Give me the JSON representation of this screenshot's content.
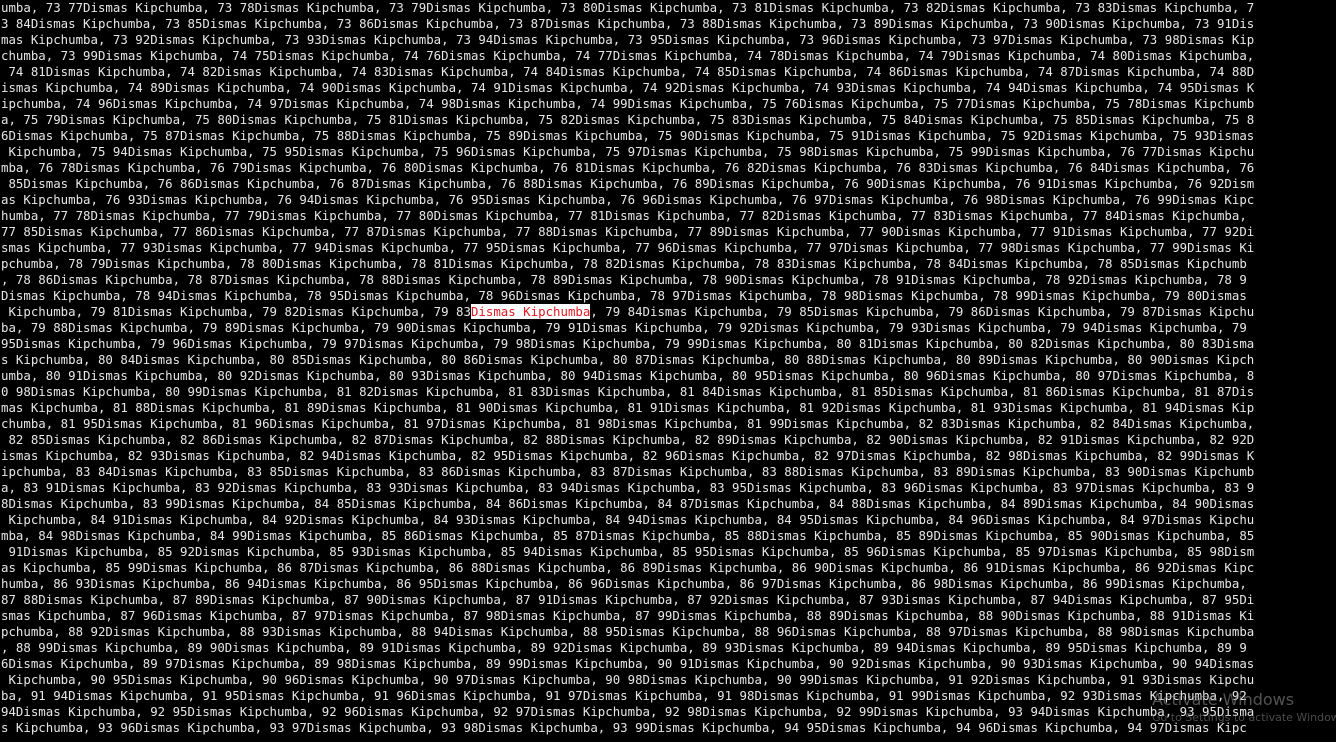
{
  "terminal": {
    "lines": [
      "umba, 73 77Dismas Kipchumba, 73 78Dismas Kipchumba, 73 79Dismas Kipchumba, 73 80Dismas Kipchumba, 73 81Dismas Kipchumba, 73 82Dismas Kipchumba, 73 83Dismas Kipchumba, 7",
      "3 84Dismas Kipchumba, 73 85Dismas Kipchumba, 73 86Dismas Kipchumba, 73 87Dismas Kipchumba, 73 88Dismas Kipchumba, 73 89Dismas Kipchumba, 73 90Dismas Kipchumba, 73 91Dis",
      "mas Kipchumba, 73 92Dismas Kipchumba, 73 93Dismas Kipchumba, 73 94Dismas Kipchumba, 73 95Dismas Kipchumba, 73 96Dismas Kipchumba, 73 97Dismas Kipchumba, 73 98Dismas Kip",
      "chumba, 73 99Dismas Kipchumba, 74 75Dismas Kipchumba, 74 76Dismas Kipchumba, 74 77Dismas Kipchumba, 74 78Dismas Kipchumba, 74 79Dismas Kipchumba, 74 80Dismas Kipchumba,",
      " 74 81Dismas Kipchumba, 74 82Dismas Kipchumba, 74 83Dismas Kipchumba, 74 84Dismas Kipchumba, 74 85Dismas Kipchumba, 74 86Dismas Kipchumba, 74 87Dismas Kipchumba, 74 88D",
      "ismas Kipchumba, 74 89Dismas Kipchumba, 74 90Dismas Kipchumba, 74 91Dismas Kipchumba, 74 92Dismas Kipchumba, 74 93Dismas Kipchumba, 74 94Dismas Kipchumba, 74 95Dismas K",
      "ipchumba, 74 96Dismas Kipchumba, 74 97Dismas Kipchumba, 74 98Dismas Kipchumba, 74 99Dismas Kipchumba, 75 76Dismas Kipchumba, 75 77Dismas Kipchumba, 75 78Dismas Kipchumb",
      "a, 75 79Dismas Kipchumba, 75 80Dismas Kipchumba, 75 81Dismas Kipchumba, 75 82Dismas Kipchumba, 75 83Dismas Kipchumba, 75 84Dismas Kipchumba, 75 85Dismas Kipchumba, 75 8",
      "6Dismas Kipchumba, 75 87Dismas Kipchumba, 75 88Dismas Kipchumba, 75 89Dismas Kipchumba, 75 90Dismas Kipchumba, 75 91Dismas Kipchumba, 75 92Dismas Kipchumba, 75 93Dismas",
      " Kipchumba, 75 94Dismas Kipchumba, 75 95Dismas Kipchumba, 75 96Dismas Kipchumba, 75 97Dismas Kipchumba, 75 98Dismas Kipchumba, 75 99Dismas Kipchumba, 76 77Dismas Kipchu",
      "mba, 76 78Dismas Kipchumba, 76 79Dismas Kipchumba, 76 80Dismas Kipchumba, 76 81Dismas Kipchumba, 76 82Dismas Kipchumba, 76 83Dismas Kipchumba, 76 84Dismas Kipchumba, 76",
      " 85Dismas Kipchumba, 76 86Dismas Kipchumba, 76 87Dismas Kipchumba, 76 88Dismas Kipchumba, 76 89Dismas Kipchumba, 76 90Dismas Kipchumba, 76 91Dismas Kipchumba, 76 92Dism",
      "as Kipchumba, 76 93Dismas Kipchumba, 76 94Dismas Kipchumba, 76 95Dismas Kipchumba, 76 96Dismas Kipchumba, 76 97Dismas Kipchumba, 76 98Dismas Kipchumba, 76 99Dismas Kipc",
      "humba, 77 78Dismas Kipchumba, 77 79Dismas Kipchumba, 77 80Dismas Kipchumba, 77 81Dismas Kipchumba, 77 82Dismas Kipchumba, 77 83Dismas Kipchumba, 77 84Dismas Kipchumba,",
      "77 85Dismas Kipchumba, 77 86Dismas Kipchumba, 77 87Dismas Kipchumba, 77 88Dismas Kipchumba, 77 89Dismas Kipchumba, 77 90Dismas Kipchumba, 77 91Dismas Kipchumba, 77 92Di",
      "smas Kipchumba, 77 93Dismas Kipchumba, 77 94Dismas Kipchumba, 77 95Dismas Kipchumba, 77 96Dismas Kipchumba, 77 97Dismas Kipchumba, 77 98Dismas Kipchumba, 77 99Dismas Ki",
      "pchumba, 78 79Dismas Kipchumba, 78 80Dismas Kipchumba, 78 81Dismas Kipchumba, 78 82Dismas Kipchumba, 78 83Dismas Kipchumba, 78 84Dismas Kipchumba, 78 85Dismas Kipchumb",
      ", 78 86Dismas Kipchumba, 78 87Dismas Kipchumba, 78 88Dismas Kipchumba, 78 89Dismas Kipchumba, 78 90Dismas Kipchumba, 78 91Dismas Kipchumba, 78 92Dismas Kipchumba, 78 9",
      "Dismas Kipchumba, 78 94Dismas Kipchumba, 78 95Dismas Kipchumba, 78 96Dismas Kipchumba, 78 97Dismas Kipchumba, 78 98Dismas Kipchumba, 78 99Dismas Kipchumba, 79 80Dismas"
    ],
    "hl_before": " Kipchumba, 79 81Dismas Kipchumba, 79 82Dismas Kipchumba, 79 83",
    "hl_text": "Dismas Kipchumba",
    "hl_after": ", 79 84Dismas Kipchumba, 79 85Dismas Kipchumba, 79 86Dismas Kipchumba, 79 87Dismas Kipchu",
    "lines2": [
      "ba, 79 88Dismas Kipchumba, 79 89Dismas Kipchumba, 79 90Dismas Kipchumba, 79 91Dismas Kipchumba, 79 92Dismas Kipchumba, 79 93Dismas Kipchumba, 79 94Dismas Kipchumba, 79",
      "95Dismas Kipchumba, 79 96Dismas Kipchumba, 79 97Dismas Kipchumba, 79 98Dismas Kipchumba, 79 99Dismas Kipchumba, 80 81Dismas Kipchumba, 80 82Dismas Kipchumba, 80 83Disma",
      "s Kipchumba, 80 84Dismas Kipchumba, 80 85Dismas Kipchumba, 80 86Dismas Kipchumba, 80 87Dismas Kipchumba, 80 88Dismas Kipchumba, 80 89Dismas Kipchumba, 80 90Dismas Kipch",
      "umba, 80 91Dismas Kipchumba, 80 92Dismas Kipchumba, 80 93Dismas Kipchumba, 80 94Dismas Kipchumba, 80 95Dismas Kipchumba, 80 96Dismas Kipchumba, 80 97Dismas Kipchumba, 8",
      "0 98Dismas Kipchumba, 80 99Dismas Kipchumba, 81 82Dismas Kipchumba, 81 83Dismas Kipchumba, 81 84Dismas Kipchumba, 81 85Dismas Kipchumba, 81 86Dismas Kipchumba, 81 87Dis",
      "mas Kipchumba, 81 88Dismas Kipchumba, 81 89Dismas Kipchumba, 81 90Dismas Kipchumba, 81 91Dismas Kipchumba, 81 92Dismas Kipchumba, 81 93Dismas Kipchumba, 81 94Dismas Kip",
      "chumba, 81 95Dismas Kipchumba, 81 96Dismas Kipchumba, 81 97Dismas Kipchumba, 81 98Dismas Kipchumba, 81 99Dismas Kipchumba, 82 83Dismas Kipchumba, 82 84Dismas Kipchumba,",
      " 82 85Dismas Kipchumba, 82 86Dismas Kipchumba, 82 87Dismas Kipchumba, 82 88Dismas Kipchumba, 82 89Dismas Kipchumba, 82 90Dismas Kipchumba, 82 91Dismas Kipchumba, 82 92D",
      "ismas Kipchumba, 82 93Dismas Kipchumba, 82 94Dismas Kipchumba, 82 95Dismas Kipchumba, 82 96Dismas Kipchumba, 82 97Dismas Kipchumba, 82 98Dismas Kipchumba, 82 99Dismas K",
      "ipchumba, 83 84Dismas Kipchumba, 83 85Dismas Kipchumba, 83 86Dismas Kipchumba, 83 87Dismas Kipchumba, 83 88Dismas Kipchumba, 83 89Dismas Kipchumba, 83 90Dismas Kipchumb",
      "a, 83 91Dismas Kipchumba, 83 92Dismas Kipchumba, 83 93Dismas Kipchumba, 83 94Dismas Kipchumba, 83 95Dismas Kipchumba, 83 96Dismas Kipchumba, 83 97Dismas Kipchumba, 83 9",
      "8Dismas Kipchumba, 83 99Dismas Kipchumba, 84 85Dismas Kipchumba, 84 86Dismas Kipchumba, 84 87Dismas Kipchumba, 84 88Dismas Kipchumba, 84 89Dismas Kipchumba, 84 90Dismas",
      " Kipchumba, 84 91Dismas Kipchumba, 84 92Dismas Kipchumba, 84 93Dismas Kipchumba, 84 94Dismas Kipchumba, 84 95Dismas Kipchumba, 84 96Dismas Kipchumba, 84 97Dismas Kipchu",
      "mba, 84 98Dismas Kipchumba, 84 99Dismas Kipchumba, 85 86Dismas Kipchumba, 85 87Dismas Kipchumba, 85 88Dismas Kipchumba, 85 89Dismas Kipchumba, 85 90Dismas Kipchumba, 85",
      " 91Dismas Kipchumba, 85 92Dismas Kipchumba, 85 93Dismas Kipchumba, 85 94Dismas Kipchumba, 85 95Dismas Kipchumba, 85 96Dismas Kipchumba, 85 97Dismas Kipchumba, 85 98Dism",
      "as Kipchumba, 85 99Dismas Kipchumba, 86 87Dismas Kipchumba, 86 88Dismas Kipchumba, 86 89Dismas Kipchumba, 86 90Dismas Kipchumba, 86 91Dismas Kipchumba, 86 92Dismas Kipc",
      "humba, 86 93Dismas Kipchumba, 86 94Dismas Kipchumba, 86 95Dismas Kipchumba, 86 96Dismas Kipchumba, 86 97Dismas Kipchumba, 86 98Dismas Kipchumba, 86 99Dismas Kipchumba,",
      "87 88Dismas Kipchumba, 87 89Dismas Kipchumba, 87 90Dismas Kipchumba, 87 91Dismas Kipchumba, 87 92Dismas Kipchumba, 87 93Dismas Kipchumba, 87 94Dismas Kipchumba, 87 95Di",
      "smas Kipchumba, 87 96Dismas Kipchumba, 87 97Dismas Kipchumba, 87 98Dismas Kipchumba, 87 99Dismas Kipchumba, 88 89Dismas Kipchumba, 88 90Dismas Kipchumba, 88 91Dismas Ki",
      "pchumba, 88 92Dismas Kipchumba, 88 93Dismas Kipchumba, 88 94Dismas Kipchumba, 88 95Dismas Kipchumba, 88 96Dismas Kipchumba, 88 97Dismas Kipchumba, 88 98Dismas Kipchumba",
      ", 88 99Dismas Kipchumba, 89 90Dismas Kipchumba, 89 91Dismas Kipchumba, 89 92Dismas Kipchumba, 89 93Dismas Kipchumba, 89 94Dismas Kipchumba, 89 95Dismas Kipchumba, 89 9",
      "6Dismas Kipchumba, 89 97Dismas Kipchumba, 89 98Dismas Kipchumba, 89 99Dismas Kipchumba, 90 91Dismas Kipchumba, 90 92Dismas Kipchumba, 90 93Dismas Kipchumba, 90 94Dismas",
      " Kipchumba, 90 95Dismas Kipchumba, 90 96Dismas Kipchumba, 90 97Dismas Kipchumba, 90 98Dismas Kipchumba, 90 99Dismas Kipchumba, 91 92Dismas Kipchumba, 91 93Dismas Kipchu",
      "ba, 91 94Dismas Kipchumba, 91 95Dismas Kipchumba, 91 96Dismas Kipchumba, 91 97Dismas Kipchumba, 91 98Dismas Kipchumba, 91 99Dismas Kipchumba, 92 93Dismas Kipchumba, 92",
      "94Dismas Kipchumba, 92 95Dismas Kipchumba, 92 96Dismas Kipchumba, 92 97Dismas Kipchumba, 92 98Dismas Kipchumba, 92 99Dismas Kipchumba, 93 94Dismas Kipchumba, 93 95Disma",
      "s Kipchumba, 93 96Dismas Kipchumba, 93 97Dismas Kipchumba, 93 98Dismas Kipchumba, 93 99Dismas Kipchumba, 94 95Dismas Kipchumba, 94 96Dismas Kipchumba, 94 97Dismas Kipc"
    ]
  },
  "watermark": {
    "title": "Activate Windows",
    "subtitle": "Go to Settings to activate Windows."
  }
}
